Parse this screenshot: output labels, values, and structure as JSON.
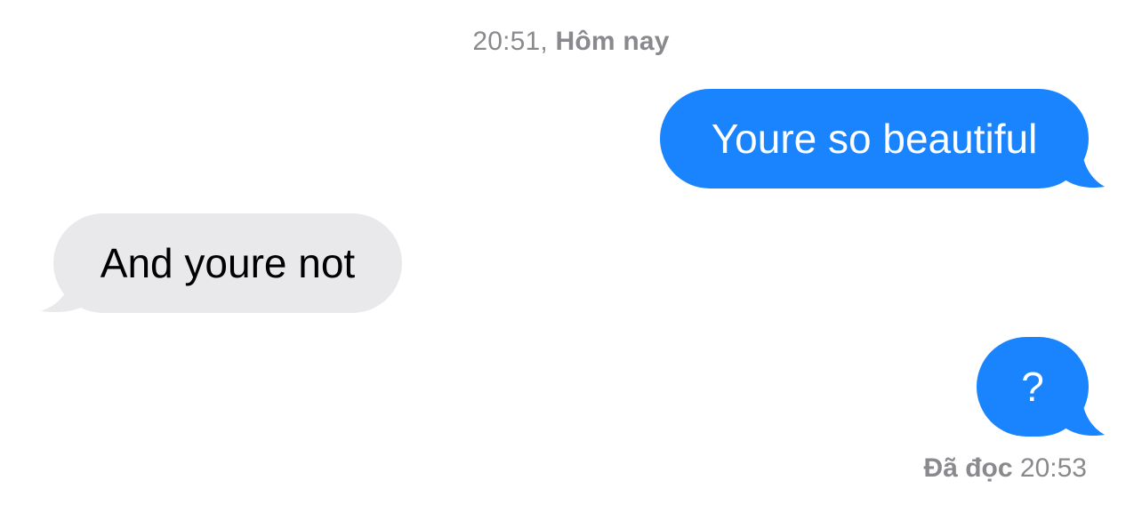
{
  "conversation": {
    "timestamp_time": "20:51,",
    "timestamp_day": "Hôm nay",
    "messages": [
      {
        "direction": "sent",
        "text": "Youre so beautiful"
      },
      {
        "direction": "received",
        "text": "And youre not"
      },
      {
        "direction": "sent",
        "text": "?"
      }
    ],
    "read_receipt_label": "Đã đọc",
    "read_receipt_time": "20:53"
  },
  "colors": {
    "sent_bubble": "#1a84ff",
    "received_bubble": "#e9e9eb",
    "meta_text": "#8a8a8e"
  }
}
